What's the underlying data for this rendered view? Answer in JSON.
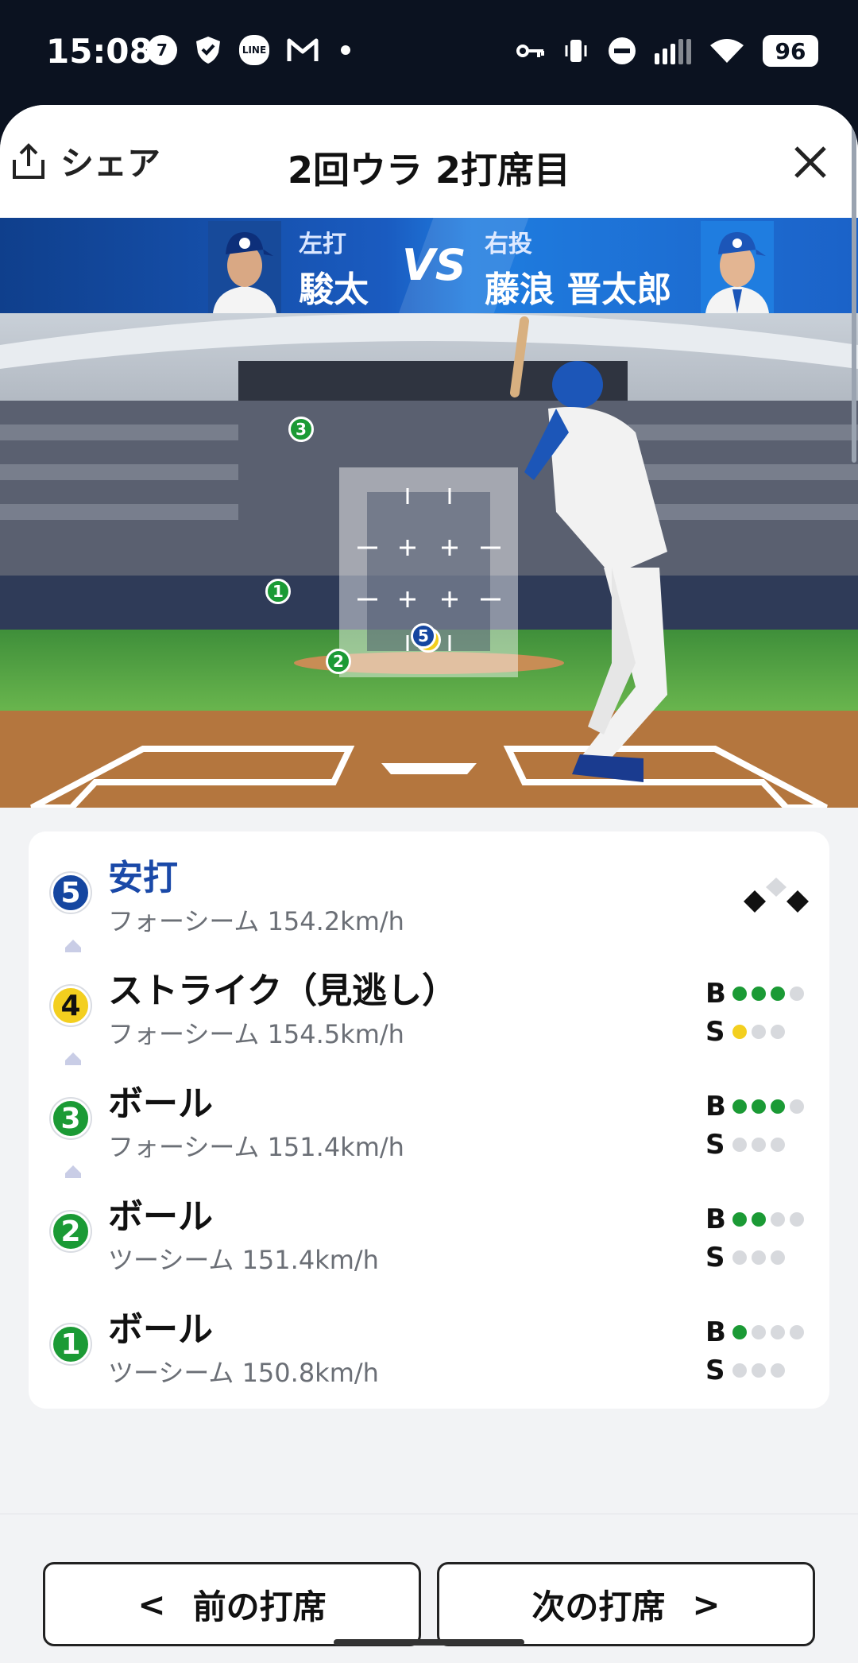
{
  "status_bar": {
    "time": "15:08",
    "left_icons": [
      "seven-eleven-icon",
      "shield-icon",
      "line-app-icon",
      "gmail-icon",
      "dot-icon"
    ],
    "right_icons": [
      "key-icon",
      "vibrate-icon",
      "do-not-disturb-icon",
      "signal-icon",
      "wifi-icon"
    ],
    "battery": "96"
  },
  "header": {
    "share_label": "シェア",
    "title": "2回ウラ 2打席目"
  },
  "matchup": {
    "batter_hand": "左打",
    "batter_name": "駿太",
    "vs_label": "VS",
    "pitcher_hand": "右投",
    "pitcher_name": "藤浪 晋太郎",
    "batter_team_color": "#0f3f8c",
    "pitcher_team_color": "#1f7de0"
  },
  "pitch_marks": [
    {
      "no": "1",
      "result": "ball"
    },
    {
      "no": "2",
      "result": "ball"
    },
    {
      "no": "3",
      "result": "ball"
    },
    {
      "no": "4",
      "result": "strike"
    },
    {
      "no": "5",
      "result": "hit"
    }
  ],
  "pitches": [
    {
      "no": "5",
      "result": "安打",
      "pitch": "フォーシーム 154.2km/h",
      "kind": "hit"
    },
    {
      "no": "4",
      "result": "ストライク（見逃し）",
      "pitch": "フォーシーム 154.5km/h",
      "kind": "strike",
      "balls": 3,
      "strikes": 1
    },
    {
      "no": "3",
      "result": "ボール",
      "pitch": "フォーシーム 151.4km/h",
      "kind": "ball",
      "balls": 3,
      "strikes": 0
    },
    {
      "no": "2",
      "result": "ボール",
      "pitch": "ツーシーム 151.4km/h",
      "kind": "ball",
      "balls": 2,
      "strikes": 0
    },
    {
      "no": "1",
      "result": "ボール",
      "pitch": "ツーシーム 150.8km/h",
      "kind": "ball",
      "balls": 1,
      "strikes": 0
    }
  ],
  "count_labels": {
    "ball": "B",
    "strike": "S"
  },
  "colors": {
    "ball": "#1b9a35",
    "strike": "#f3cf1f",
    "hit": "#1546a0",
    "hit_text": "#1a49a8"
  },
  "footer": {
    "prev_label": "前の打席",
    "next_label": "次の打席",
    "prev_arrow": "<",
    "next_arrow": ">"
  }
}
